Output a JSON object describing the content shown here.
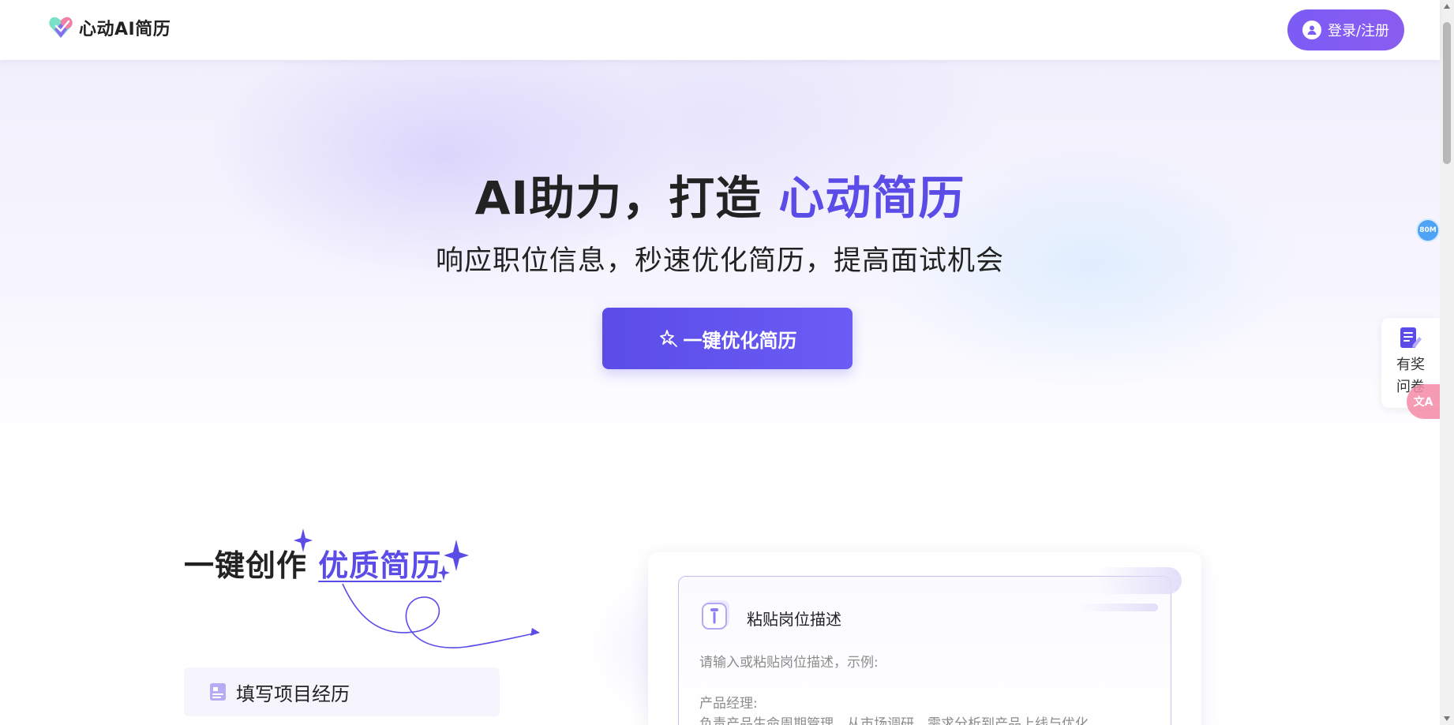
{
  "header": {
    "app_name": "心动AI简历",
    "login_label": "登录/注册"
  },
  "hero": {
    "title_prefix": "AI助力，打造 ",
    "title_accent": "心动简历",
    "subtitle": "响应职位信息，秒速优化简历，提高面试机会",
    "cta_label": "一键优化简历"
  },
  "side": {
    "speed_badge": "80M",
    "survey_label": "有奖问卷",
    "translate_label": "文A"
  },
  "section": {
    "title_prefix": "一键创作 ",
    "title_accent": "优质简历",
    "step_label": "填写项目经历"
  },
  "jd_card": {
    "title": "粘贴岗位描述",
    "placeholder": "请输入或粘贴岗位描述，示例:",
    "example_role": "产品经理:",
    "example_text": "负责产品生命周期管理，从市场调研、需求分析到产品上线与优化。"
  },
  "colors": {
    "accent": "#5b4ce8",
    "login_button": "#7b5cf5"
  }
}
